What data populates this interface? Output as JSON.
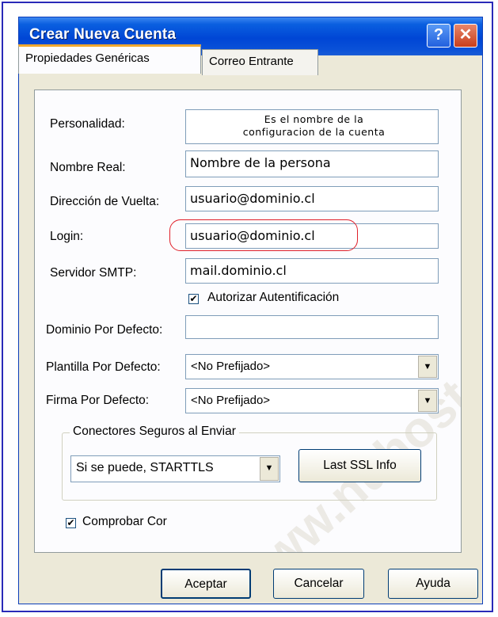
{
  "window": {
    "title": "Crear Nueva Cuenta",
    "help_glyph": "?",
    "close_glyph": "✕"
  },
  "tabs": [
    {
      "label": "Propiedades Genéricas",
      "active": true
    },
    {
      "label": "Correo Entrante",
      "active": false
    }
  ],
  "form": {
    "personalidad_label": "Personalidad:",
    "personalidad_value_line1": "Es el nombre de la",
    "personalidad_value_line2": "configuracion de la cuenta",
    "nombre_real_label": "Nombre Real:",
    "nombre_real_value": "Nombre de la persona",
    "direccion_label": "Dirección de Vuelta:",
    "direccion_value": "usuario@dominio.cl",
    "login_label": "Login:",
    "login_value": "usuario@dominio.cl",
    "smtp_label": "Servidor SMTP:",
    "smtp_value": "mail.dominio.cl",
    "autorizar_label": "Autorizar Autentificación",
    "autorizar_checked": true,
    "dominio_label": "Dominio Por Defecto:",
    "dominio_value": "",
    "plantilla_label": "Plantilla Por Defecto:",
    "plantilla_value": "<No Prefijado>",
    "firma_label": "Firma Por Defecto:",
    "firma_value": "<No Prefijado>"
  },
  "secure": {
    "group_label": "Conectores Seguros al Enviar",
    "select_value": "Si se puede, STARTTLS",
    "last_ssl_label": "Last SSL Info"
  },
  "comprobar": {
    "label": "Comprobar Cor",
    "checked": true
  },
  "buttons": {
    "ok": "Aceptar",
    "cancel": "Cancelar",
    "help": "Ayuda"
  },
  "watermark": "www.nuhost.cl",
  "colors": {
    "titlebar": "#0046d5",
    "dialog_bg": "#ece9d8",
    "highlight_oval": "#e0202a",
    "frame": "#2a2ab8"
  }
}
